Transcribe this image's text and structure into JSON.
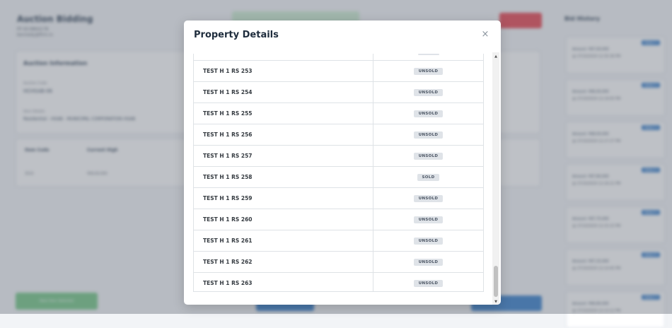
{
  "background": {
    "title": "Auction Bidding",
    "sub1": "PF-ID:9864178",
    "sub2": "kennedy@firm.in",
    "info_heading": "Auction Information",
    "info_label1": "Auction Code",
    "info_value1": "HCHSAB-06",
    "info_label2": "Item Details",
    "info_value2": "Residential - HSAB - MUNICIPAL CORPORATION HSAB",
    "table_headers": [
      "Item Code",
      "Current High"
    ],
    "table_cells": [
      "3515",
      "₹69,00,000"
    ],
    "green_button": "Next Item Selected",
    "history_title": "Bid History",
    "bids": [
      {
        "badge": "Bidder 1",
        "amount": "Amount: ₹67,00,000",
        "time": "@ 27/10/2024 12:35:36 PM"
      },
      {
        "badge": "Bidder 2",
        "amount": "Amount: ₹66,00,000",
        "time": "@ 27/10/2024 12:19:05 PM"
      },
      {
        "badge": "Bidder 3",
        "amount": "Amount: ₹68,00,000",
        "time": "@ 27/10/2024 12:17:27 PM"
      },
      {
        "badge": "Bidder 4",
        "amount": "Amount: ₹67,80,000",
        "time": "@ 27/10/2024 12:16:21 PM"
      },
      {
        "badge": "Bidder 5",
        "amount": "Amount: ₹67,75,000",
        "time": "@ 27/10/2024 12:15:15 PM"
      },
      {
        "badge": "Bidder 6",
        "amount": "Amount: ₹67,25,000",
        "time": "@ 27/10/2024 12:14:45 PM"
      },
      {
        "badge": "Bidder 7",
        "amount": "Amount: ₹66,80,000",
        "time": "@ 27/10/2024 12:13:12 PM"
      }
    ]
  },
  "modal": {
    "title": "Property Details",
    "close_icon": "×",
    "rows": [
      {
        "name": "TEST H 1 RS 253",
        "status": "UNSOLD"
      },
      {
        "name": "TEST H 1 RS 254",
        "status": "UNSOLD"
      },
      {
        "name": "TEST H 1 RS 255",
        "status": "UNSOLD"
      },
      {
        "name": "TEST H 1 RS 256",
        "status": "UNSOLD"
      },
      {
        "name": "TEST H 1 RS 257",
        "status": "UNSOLD"
      },
      {
        "name": "TEST H 1 RS 258",
        "status": "SOLD"
      },
      {
        "name": "TEST H 1 RS 259",
        "status": "UNSOLD"
      },
      {
        "name": "TEST H 1 RS 260",
        "status": "UNSOLD"
      },
      {
        "name": "TEST H 1 RS 261",
        "status": "UNSOLD"
      },
      {
        "name": "TEST H 1 RS 262",
        "status": "UNSOLD"
      },
      {
        "name": "TEST H 1 RS 263",
        "status": "UNSOLD"
      }
    ]
  },
  "colors": {
    "accent_blue": "#2b77c8",
    "danger_red": "#e63946",
    "success_green": "#6cc47f",
    "badge_bg": "#dfe3e8"
  }
}
